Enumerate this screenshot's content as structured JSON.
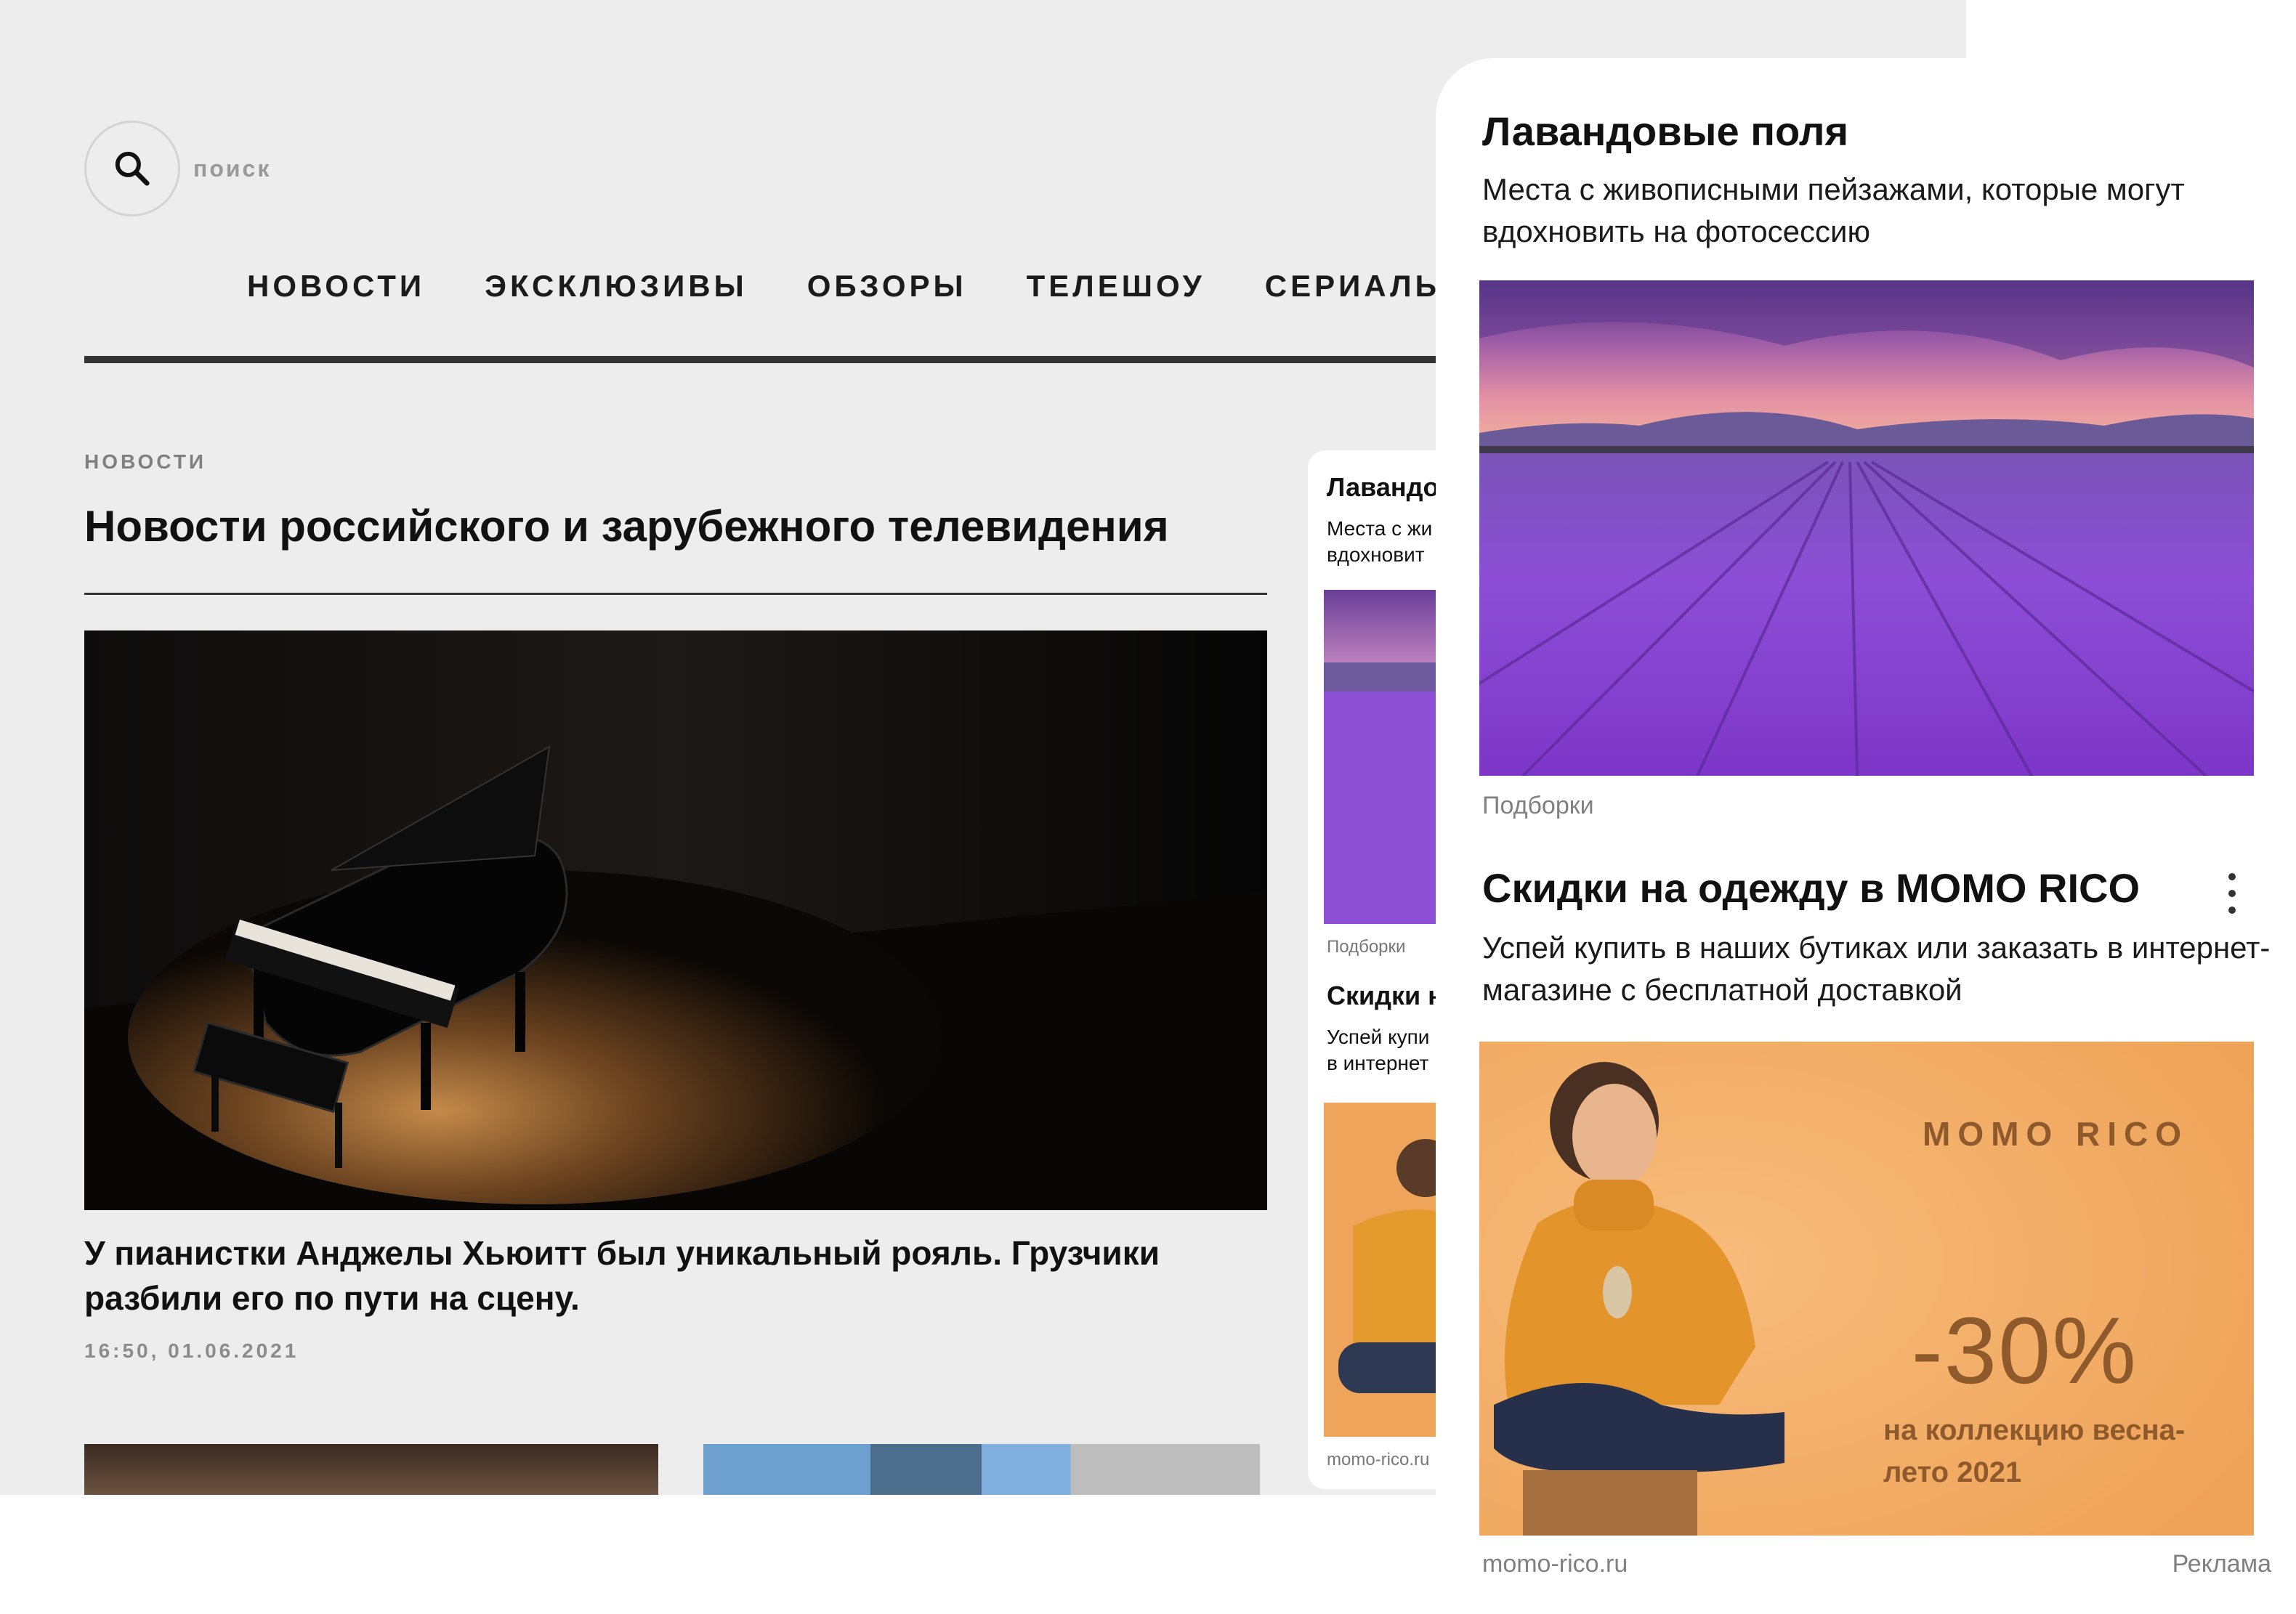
{
  "search": {
    "placeholder": "поиск"
  },
  "nav": {
    "items": [
      {
        "label": "НОВОСТИ"
      },
      {
        "label": "ЭКСКЛЮЗИВЫ"
      },
      {
        "label": "ОБЗОРЫ"
      },
      {
        "label": "ТЕЛЕШОУ"
      },
      {
        "label": "СЕРИАЛЫ"
      }
    ]
  },
  "section": {
    "label": "НОВОСТИ",
    "title": "Новости российского и зарубежного телевидения"
  },
  "hero": {
    "headline": "У пианистки Анджелы Хьюитт был уникальный рояль. Грузчики разбили его по пути на сцену.",
    "date": "16:50, 01.06.2021"
  },
  "mini_feed": {
    "title1": "Лавандо",
    "desc1_line1": "Места с жи",
    "desc1_line2": "вдохновит",
    "category": "Подборки",
    "title2": "Скидки н",
    "desc2_line1": "Успей купи",
    "desc2_line2": "в интернет",
    "domain": "momo-rico.ru"
  },
  "card": {
    "item1": {
      "title": "Лавандовые поля",
      "description": "Места с живописными пейзажами, которые могут вдохновить на фотосессию",
      "category": "Подборки"
    },
    "item2": {
      "title": "Скидки на одежду в MOMO RICO",
      "description": "Успей купить в наших бутиках или заказать в интернет-магазине с бесплатной доставкой",
      "brand": "MOMO RICO",
      "discount": "-30%",
      "promo": "на коллекцию весна-лето 2021",
      "domain": "momo-rico.ru",
      "ad_label": "Реклама"
    }
  },
  "colors": {
    "background": "#ededed",
    "card": "#ffffff",
    "ad_orange": "#f3ad67",
    "ad_brown": "#8e5a2c",
    "lavender": "#8a4fd0"
  },
  "icons": {
    "search": "search-icon",
    "more": "more-vertical-icon"
  }
}
